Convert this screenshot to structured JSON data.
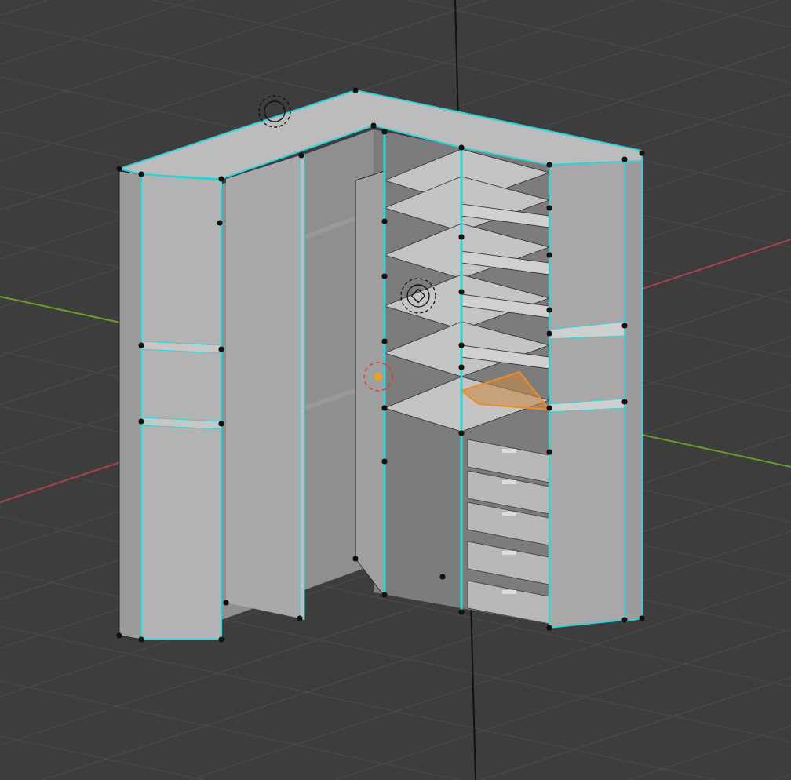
{
  "viewport": {
    "axes": [
      {
        "kind": "x",
        "color": "#a8424f"
      },
      {
        "kind": "y",
        "color": "#6b9a2a"
      }
    ]
  }
}
